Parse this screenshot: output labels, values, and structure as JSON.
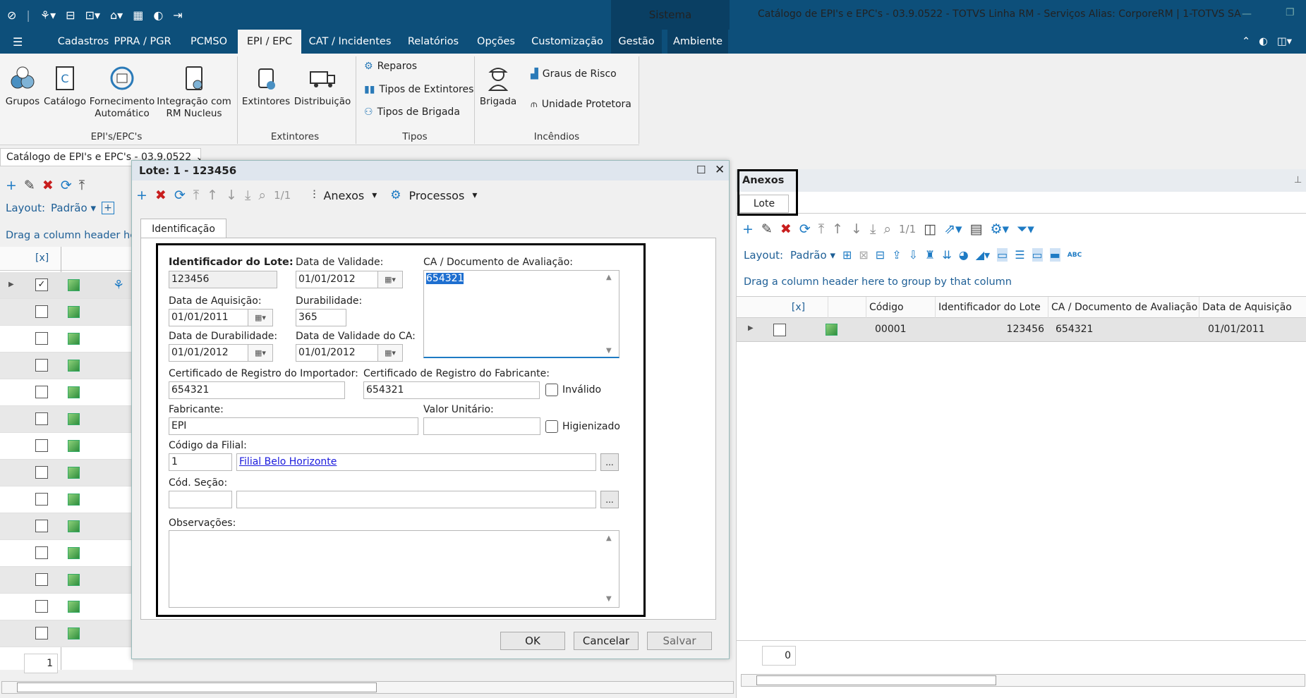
{
  "app": {
    "sistema": "Sistema",
    "window_title": "Catálogo de EPI's e EPC's - 03.9.0522 - TOTVS Linha RM - Serviços  Alias: CorporeRM | 1-TOTVS SA"
  },
  "menu": [
    "Cadastros",
    "PPRA / PGR",
    "PCMSO",
    "EPI / EPC",
    "CAT / Incidentes",
    "Relatórios",
    "Opções",
    "Customização",
    "Gestão",
    "Ambiente"
  ],
  "ribbon": {
    "groups": [
      {
        "label": "EPI's/EPC's",
        "buttons": [
          "Grupos",
          "Catálogo",
          "Fornecimento\nAutomático",
          "Integração com\nRM Nucleus"
        ]
      },
      {
        "label": "Extintores",
        "buttons": [
          "Extintores",
          "Distribuição"
        ]
      },
      {
        "label": "Tipos",
        "small": [
          "Reparos",
          "Tipos de Extintores",
          "Tipos de Brigada"
        ]
      },
      {
        "label": "Incêndios",
        "buttons": [
          "Brigada"
        ],
        "small": [
          "Graus de Risco",
          "Unidade Protetora"
        ]
      }
    ]
  },
  "doc_tab": "Catálogo de EPI's e EPC's - 03.9.0522",
  "left_panel": {
    "layout_label": "Layout:",
    "layout_value": "Padrão",
    "group_hint": "Drag a column header here t",
    "col_select": "[x]",
    "rows": 14,
    "footer_count": "1"
  },
  "dialog": {
    "title": "Lote: 1 - 123456",
    "page": "1/1",
    "anexos": "Anexos",
    "processos": "Processos",
    "tab": "Identificação",
    "fields": {
      "identificador_label": "Identificador do Lote:",
      "identificador": "123456",
      "data_validade_label": "Data de Validade:",
      "data_validade": "01/01/2012",
      "ca_label": "CA / Documento de Avaliação:",
      "ca": "654321",
      "data_aquisicao_label": "Data de Aquisição:",
      "data_aquisicao": "01/01/2011",
      "durabilidade_label": "Durabilidade:",
      "durabilidade": "365",
      "data_durabilidade_label": "Data de Durabilidade:",
      "data_durabilidade": "01/01/2012",
      "data_validade_ca_label": "Data de Validade do CA:",
      "data_validade_ca": "01/01/2012",
      "cert_importador_label": "Certificado de Registro do Importador:",
      "cert_importador": "654321",
      "cert_fabricante_label": "Certificado de Registro do Fabricante:",
      "cert_fabricante": "654321",
      "invalido_label": "Inválido",
      "fabricante_label": "Fabricante:",
      "fabricante": "EPI",
      "valor_unitario_label": "Valor Unitário:",
      "valor_unitario": "",
      "higienizado_label": "Higienizado",
      "codigo_filial_label": "Código da Filial:",
      "codigo_filial": "1",
      "filial_nome": "Filial Belo Horizonte",
      "cod_secao_label": "Cód. Seção:",
      "cod_secao": "",
      "observacoes_label": "Observações:",
      "observacoes": ""
    },
    "buttons": {
      "ok": "OK",
      "cancel": "Cancelar",
      "save": "Salvar"
    }
  },
  "anexos_panel": {
    "title": "Anexos",
    "tab": "Lote",
    "page": "1/1",
    "layout_label": "Layout:",
    "layout_value": "Padrão",
    "group_hint": "Drag a column header here to group by that column",
    "columns": [
      "[x]",
      "",
      "Código",
      "Identificador do Lote",
      "CA / Documento de Avaliação",
      "Data de Aquisição"
    ],
    "rows": [
      {
        "codigo": "00001",
        "identificador": "123456",
        "ca": "654321",
        "data_aquisicao": "01/01/2011"
      }
    ],
    "footer_count": "0"
  }
}
